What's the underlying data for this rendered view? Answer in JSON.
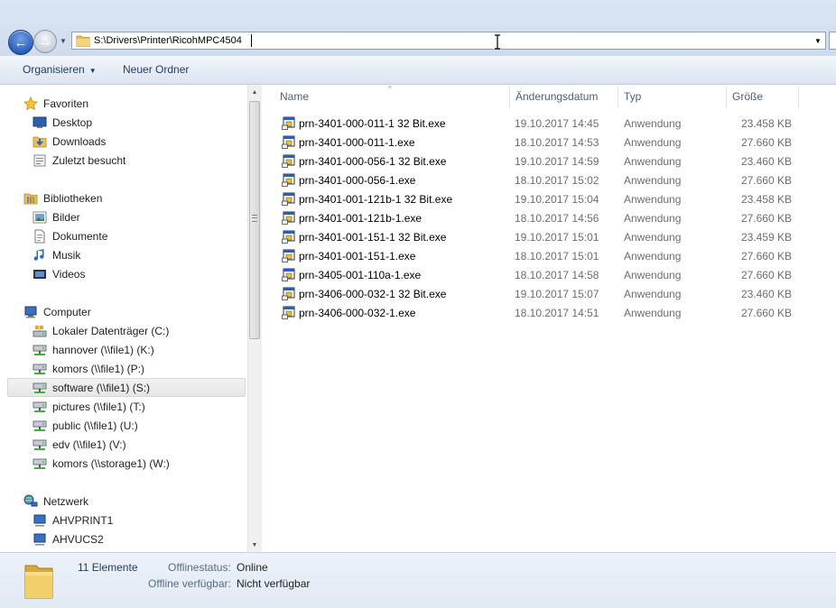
{
  "address": {
    "path": "S:\\Drivers\\Printer\\RicohMPC4504"
  },
  "icons": {
    "back": "back-arrow-icon",
    "forward": "forward-arrow-icon",
    "folder": "folder-icon",
    "app": "application-exe-icon"
  },
  "toolbar": {
    "organize_label": "Organisieren",
    "new_folder_label": "Neuer Ordner"
  },
  "nav": {
    "favorites": {
      "label": "Favoriten",
      "items": [
        {
          "label": "Desktop"
        },
        {
          "label": "Downloads"
        },
        {
          "label": "Zuletzt besucht"
        }
      ]
    },
    "libraries": {
      "label": "Bibliotheken",
      "items": [
        {
          "label": "Bilder"
        },
        {
          "label": "Dokumente"
        },
        {
          "label": "Musik"
        },
        {
          "label": "Videos"
        }
      ]
    },
    "computer": {
      "label": "Computer",
      "items": [
        {
          "label": "Lokaler Datenträger (C:)"
        },
        {
          "label": "hannover (\\\\file1) (K:)"
        },
        {
          "label": "komors (\\\\file1) (P:)"
        },
        {
          "label": "software (\\\\file1) (S:)",
          "selected": true
        },
        {
          "label": "pictures (\\\\file1) (T:)"
        },
        {
          "label": "public (\\\\file1) (U:)"
        },
        {
          "label": "edv (\\\\file1) (V:)"
        },
        {
          "label": "komors (\\\\storage1) (W:)"
        }
      ]
    },
    "network": {
      "label": "Netzwerk",
      "items": [
        {
          "label": "AHVPRINT1"
        },
        {
          "label": "AHVUCS2"
        }
      ]
    }
  },
  "columns": {
    "name": "Name",
    "date": "Änderungsdatum",
    "type": "Typ",
    "size": "Größe"
  },
  "files": [
    {
      "name": "prn-3401-000-011-1 32 Bit.exe",
      "date": "19.10.2017 14:45",
      "type": "Anwendung",
      "size": "23.458 KB"
    },
    {
      "name": "prn-3401-000-011-1.exe",
      "date": "18.10.2017 14:53",
      "type": "Anwendung",
      "size": "27.660 KB"
    },
    {
      "name": "prn-3401-000-056-1 32 Bit.exe",
      "date": "19.10.2017 14:59",
      "type": "Anwendung",
      "size": "23.460 KB"
    },
    {
      "name": "prn-3401-000-056-1.exe",
      "date": "18.10.2017 15:02",
      "type": "Anwendung",
      "size": "27.660 KB"
    },
    {
      "name": "prn-3401-001-121b-1 32 Bit.exe",
      "date": "19.10.2017 15:04",
      "type": "Anwendung",
      "size": "23.458 KB"
    },
    {
      "name": "prn-3401-001-121b-1.exe",
      "date": "18.10.2017 14:56",
      "type": "Anwendung",
      "size": "27.660 KB"
    },
    {
      "name": "prn-3401-001-151-1 32 Bit.exe",
      "date": "19.10.2017 15:01",
      "type": "Anwendung",
      "size": "23.459 KB"
    },
    {
      "name": "prn-3401-001-151-1.exe",
      "date": "18.10.2017 15:01",
      "type": "Anwendung",
      "size": "27.660 KB"
    },
    {
      "name": "prn-3405-001-110a-1.exe",
      "date": "18.10.2017 14:58",
      "type": "Anwendung",
      "size": "27.660 KB"
    },
    {
      "name": "prn-3406-000-032-1 32 Bit.exe",
      "date": "19.10.2017 15:07",
      "type": "Anwendung",
      "size": "23.460 KB"
    },
    {
      "name": "prn-3406-000-032-1.exe",
      "date": "18.10.2017 14:51",
      "type": "Anwendung",
      "size": "27.660 KB"
    }
  ],
  "status": {
    "count": "11 Elemente",
    "offline_status_label": "Offlinestatus:",
    "offline_status_value": "Online",
    "offline_avail_label": "Offline verfügbar:",
    "offline_avail_value": "Nicht verfügbar"
  }
}
